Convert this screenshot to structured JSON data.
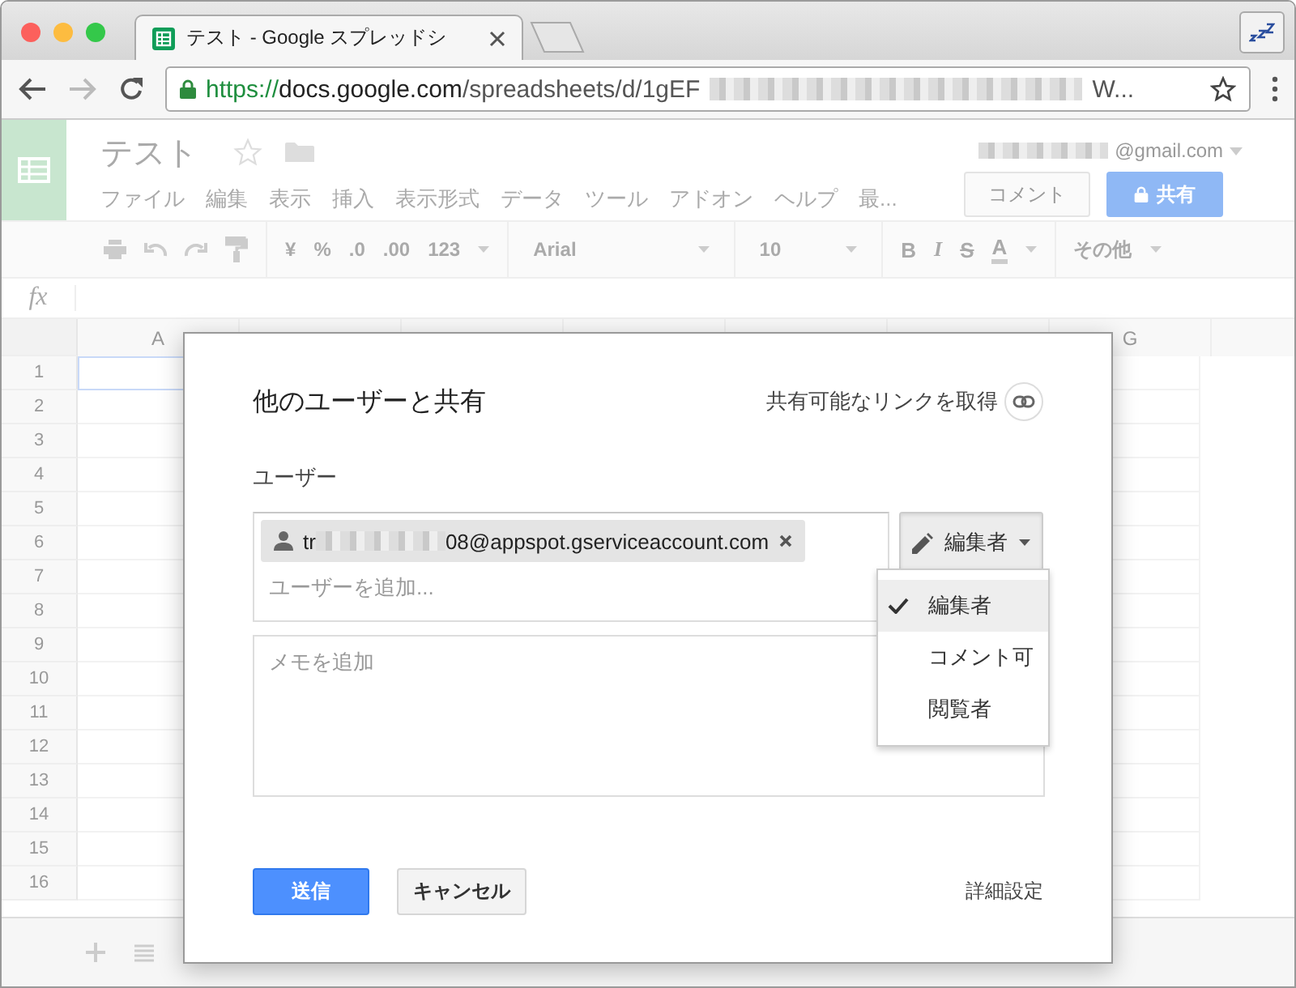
{
  "browser": {
    "tab_title": "テスト - Google スプレッドシ",
    "url_scheme": "https://",
    "url_host": "docs.google.com",
    "url_path": "/spreadsheets/d/1gEF",
    "url_end": "W..."
  },
  "app": {
    "doc_title": "テスト",
    "account": "@gmail.com",
    "menus": [
      "ファイル",
      "編集",
      "表示",
      "挿入",
      "表示形式",
      "データ",
      "ツール",
      "アドオン",
      "ヘルプ",
      "最..."
    ],
    "comment_button": "コメント",
    "share_button": "共有"
  },
  "toolbar": {
    "number_formats": [
      "¥",
      "%",
      ".0",
      ".00",
      "123"
    ],
    "font": "Arial",
    "font_size": "10",
    "text_formats": [
      "B",
      "I",
      "S",
      "A"
    ],
    "more": "その他"
  },
  "formula_bar": {
    "label": "fx"
  },
  "grid": {
    "columns": [
      "A",
      "G"
    ],
    "rows": [
      "1",
      "2",
      "3",
      "4",
      "5",
      "6",
      "7",
      "8",
      "9",
      "10",
      "11",
      "12",
      "13",
      "14",
      "15",
      "16"
    ]
  },
  "dialog": {
    "title": "他のユーザーと共有",
    "link_button": "共有可能なリンクを取得",
    "users_label": "ユーザー",
    "chip": {
      "prefix": "tr",
      "suffix": "08@appspot.gserviceaccount.com"
    },
    "add_placeholder": "ユーザーを追加...",
    "role_button": {
      "label": "編集者",
      "expanded": true
    },
    "role_menu": [
      {
        "label": "編集者",
        "selected": true
      },
      {
        "label": "コメント可",
        "selected": false
      },
      {
        "label": "閲覧者",
        "selected": false
      }
    ],
    "note_placeholder": "メモを追加",
    "send_button": "送信",
    "cancel_button": "キャンセル",
    "advanced_link": "詳細設定"
  }
}
